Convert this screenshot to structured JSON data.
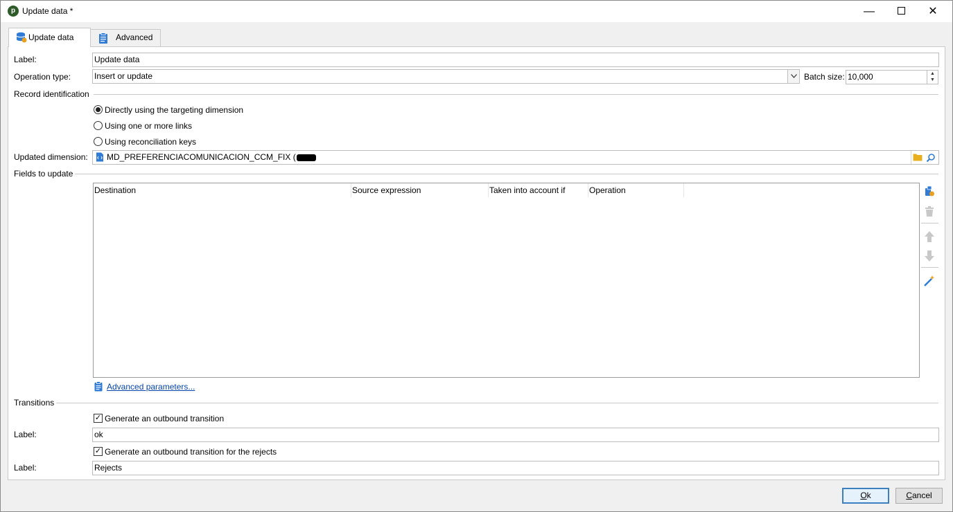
{
  "window": {
    "title": "Update data *",
    "app_icon_glyph": "p"
  },
  "tabs": [
    {
      "label": "Update data"
    },
    {
      "label": "Advanced"
    }
  ],
  "form": {
    "label_caption": "Label:",
    "label_value": "Update data",
    "operation_type_caption": "Operation type:",
    "operation_type_value": "Insert or update",
    "batch_size_caption": "Batch size:",
    "batch_size_value": "10,000"
  },
  "record_identification": {
    "section_title": "Record identification",
    "options": [
      {
        "label": "Directly using the targeting dimension",
        "selected": true
      },
      {
        "label": "Using one or more links",
        "selected": false
      },
      {
        "label": "Using reconciliation keys",
        "selected": false
      }
    ],
    "updated_dimension_caption": "Updated dimension:",
    "updated_dimension_value": "MD_PREFERENCIACOMUNICACION_CCM_FIX ("
  },
  "fields_to_update": {
    "section_title": "Fields to update",
    "columns": [
      "Destination",
      "Source expression",
      "Taken into account if",
      "Operation"
    ],
    "rows": [],
    "advanced_link": "Advanced parameters..."
  },
  "transitions": {
    "section_title": "Transitions",
    "outbound_checkbox_label": "Generate an outbound transition",
    "outbound_checked": true,
    "outbound_label_caption": "Label:",
    "outbound_label_value": "ok",
    "rejects_checkbox_label": "Generate an outbound transition for the rejects",
    "rejects_checked": true,
    "rejects_label_caption": "Label:",
    "rejects_label_value": "Rejects"
  },
  "footer": {
    "ok_label": "Ok",
    "ok_mnemonic": "O",
    "ok_rest": "k",
    "cancel_label": "Cancel",
    "cancel_mnemonic": "C",
    "cancel_rest": "ancel"
  },
  "colors": {
    "accent": "#3c7fc1",
    "link": "#0645ad",
    "icon_blue": "#2f7bd6",
    "folder": "#e8b020"
  },
  "icons": {
    "tab_update": "database-sync-icon",
    "tab_advanced": "clipboard-icon",
    "dimension": "schema-document-icon",
    "folder": "folder-icon",
    "search": "magnifier-icon",
    "add": "add-field-icon",
    "delete": "trash-icon",
    "up": "arrow-up-icon",
    "down": "arrow-down-icon",
    "wizard": "magic-wand-icon"
  }
}
